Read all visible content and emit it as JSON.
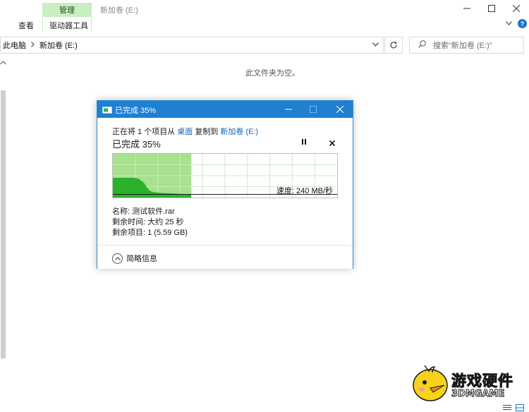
{
  "ribbon": {
    "context_group_label": "管理",
    "window_title": "新加卷 (E:)",
    "tabs": [
      {
        "label": "查看"
      },
      {
        "label": "驱动器工具"
      }
    ]
  },
  "address": {
    "crumbs": [
      "此电脑",
      "新加卷 (E:)"
    ]
  },
  "search": {
    "placeholder": "搜索\"新加卷 (E:)\""
  },
  "content": {
    "empty_message": "此文件夹为空。"
  },
  "dialog": {
    "title": "已完成 35%",
    "line_prefix": "正在将 1 个项目从 ",
    "source": "桌面",
    "line_mid": " 复制到 ",
    "destination": "新加卷 (E:)",
    "percent_label": "已完成 35%",
    "progress_fraction": 0.35,
    "speed_label": "速度: 240 MB/秒",
    "name_line": "名称: 测试软件.rar",
    "time_remaining_line": "剩余时间: 大约 25 秒",
    "items_remaining_line": "剩余项目: 1 (5.59 GB)",
    "details_label": "简略信息"
  },
  "watermark": {
    "line1": "游戏硬件",
    "line2": "3DMGAME"
  },
  "colors": {
    "accent_blue": "#1f7fd1",
    "progress_fill": "#a6e28f",
    "speed_area": "#2bb12b",
    "context_tab_bg": "#c9eec1"
  },
  "icons": {
    "window_controls": [
      "minimize-icon",
      "maximize-icon",
      "close-icon"
    ],
    "dialog_controls": [
      "minimize-icon",
      "maximize-icon",
      "close-icon"
    ],
    "address": [
      "chevron-down-icon",
      "refresh-icon"
    ],
    "search": "search-icon",
    "dialog": [
      "pause-icon",
      "cancel-icon",
      "chevron-up-icon"
    ]
  }
}
